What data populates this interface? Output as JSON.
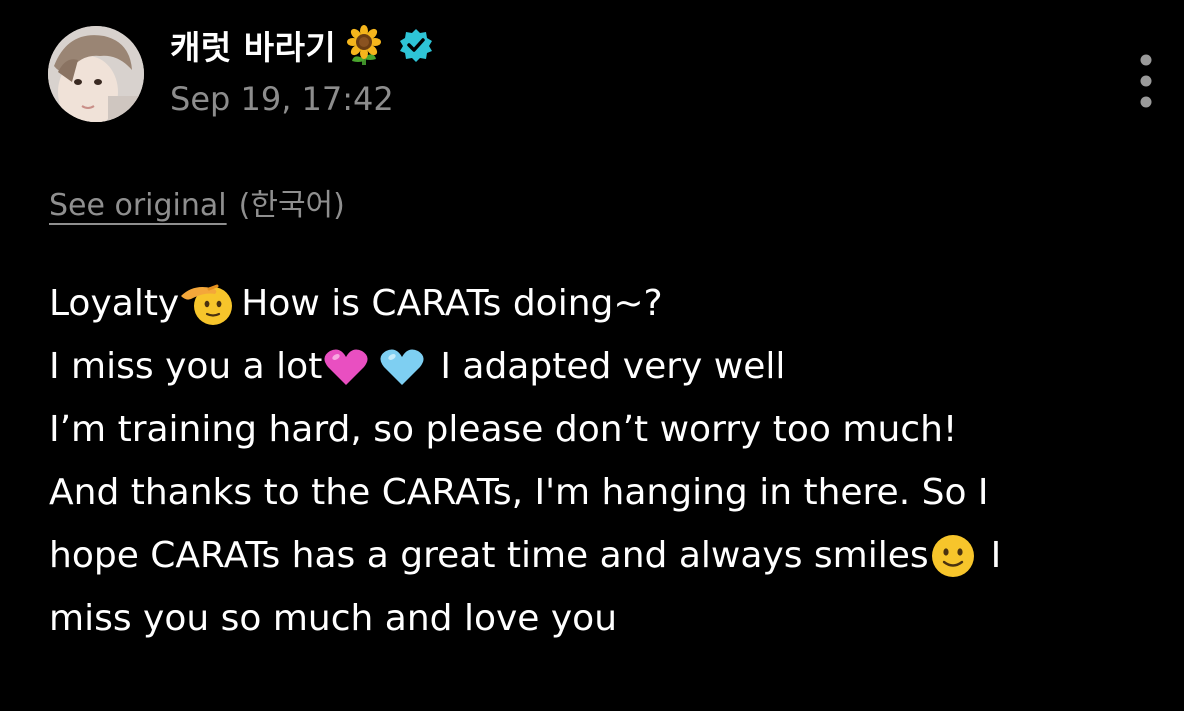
{
  "author": {
    "name": "캐럿 바라기",
    "name_emoji": "sunflower-emoji",
    "verified": true,
    "timestamp": "Sep 19, 17:42"
  },
  "translation": {
    "see_original_label": "See original",
    "language_label": "(한국어)"
  },
  "post": {
    "line1": {
      "text_a": "Loyalty",
      "emoji_a": "saluting-face-emoji",
      "text_b": "How is CARATs doing~?"
    },
    "line2": {
      "text_a": "I miss you a lot",
      "emoji_a": "pink-heart-emoji",
      "emoji_b": "light-blue-heart-emoji",
      "text_b": "I adapted very well"
    },
    "line3": {
      "text_a": "I’m training hard, so please don’t worry too much!"
    },
    "line4": {
      "text_a": "And thanks to the CARATs, I'm hanging in there. So I"
    },
    "line5": {
      "text_a": "hope CARATs has a great time and always smiles",
      "emoji_a": "slightly-smiling-face-emoji",
      "text_b": "I"
    },
    "line6": {
      "text_a": "miss you so much and love you"
    }
  },
  "colors": {
    "background": "#000000",
    "primary_text": "#ffffff",
    "secondary_text": "#8d8d8d",
    "verified_badge": "#2ec4d6"
  }
}
